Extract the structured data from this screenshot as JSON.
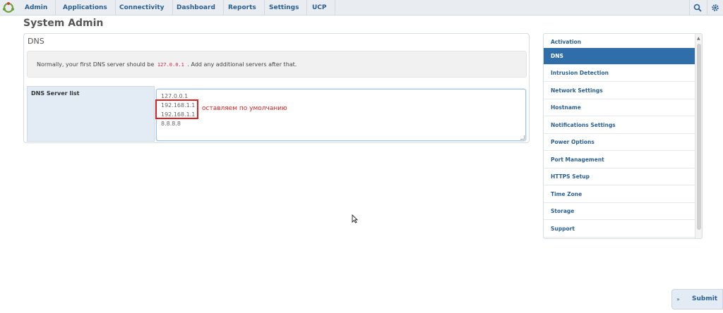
{
  "nav": {
    "items": [
      {
        "label": "Admin"
      },
      {
        "label": "Applications"
      },
      {
        "label": "Connectivity"
      },
      {
        "label": "Dashboard"
      },
      {
        "label": "Reports"
      },
      {
        "label": "Settings"
      },
      {
        "label": "UCP"
      }
    ],
    "search_icon": "search-icon",
    "settings_icon": "gear-icon"
  },
  "page": {
    "title": "System Admin"
  },
  "dns": {
    "panel_title": "DNS",
    "info_prefix": "Normally, your first DNS server should be",
    "info_code": "127.0.0.1",
    "info_suffix": ". Add any additional servers after that.",
    "server_list_label": "DNS Server list",
    "servers": [
      "127.0.0.1",
      "192.168.1.1",
      "192.168.1.1",
      "8.8.8.8"
    ],
    "annotation": "оставляем по умолчанию"
  },
  "sidebar": {
    "items": [
      {
        "label": "Activation"
      },
      {
        "label": "DNS"
      },
      {
        "label": "Intrusion Detection"
      },
      {
        "label": "Network Settings"
      },
      {
        "label": "Hostname"
      },
      {
        "label": "Notifications Settings"
      },
      {
        "label": "Power Options"
      },
      {
        "label": "Port Management"
      },
      {
        "label": "HTTPS Setup"
      },
      {
        "label": "Time Zone"
      },
      {
        "label": "Storage"
      },
      {
        "label": "Support"
      }
    ],
    "active_index": 1
  },
  "submit": {
    "label": "Submit"
  },
  "colors": {
    "accent": "#2f6ea8",
    "nav_text": "#2a5f8f",
    "annotation": "#e02020"
  }
}
